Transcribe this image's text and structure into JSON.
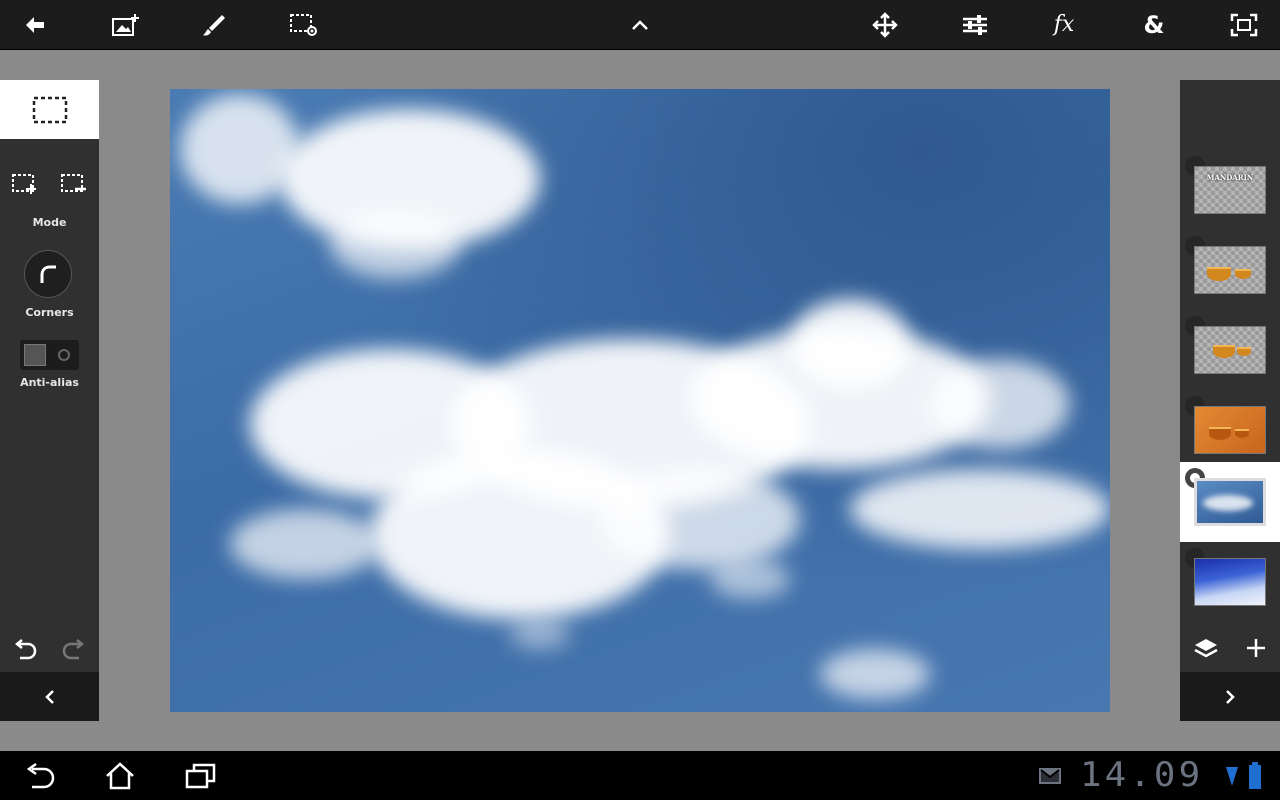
{
  "toolbar": {
    "icons": [
      "back-arrow-icon",
      "add-image-icon",
      "brush-icon",
      "selection-settings-icon",
      "chevron-up-icon",
      "move-icon",
      "adjustments-icon",
      "fx-icon",
      "ampersand-icon",
      "fullscreen-icon"
    ],
    "fx_label": "fx",
    "amp_label": "&"
  },
  "left_panel": {
    "mode_label": "Mode",
    "corners_label": "Corners",
    "antialias_label": "Anti-alias"
  },
  "layers": {
    "items": [
      {
        "type": "text",
        "thumb_text": "MANDARIN"
      },
      {
        "type": "object"
      },
      {
        "type": "object"
      },
      {
        "type": "orange"
      },
      {
        "type": "sky",
        "selected": true
      },
      {
        "type": "gradient"
      }
    ]
  },
  "system_bar": {
    "clock": "14.09"
  },
  "colors": {
    "toolbar_bg": "#1c1c1c",
    "panel_bg": "#303030",
    "workspace_bg": "#8a8a8a",
    "sky": "#4877b0",
    "clock": "#6c7482"
  }
}
